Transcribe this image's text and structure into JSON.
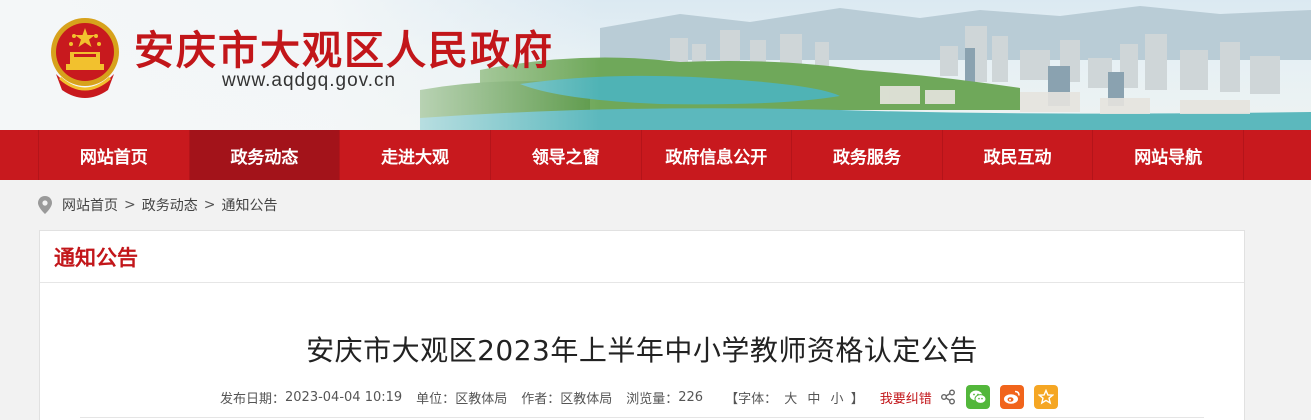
{
  "header": {
    "site_title": "安庆市大观区人民政府",
    "site_url": "www.aqdgq.gov.cn"
  },
  "nav": {
    "items": [
      {
        "label": "网站首页"
      },
      {
        "label": "政务动态"
      },
      {
        "label": "走进大观"
      },
      {
        "label": "领导之窗"
      },
      {
        "label": "政府信息公开"
      },
      {
        "label": "政务服务"
      },
      {
        "label": "政民互动"
      },
      {
        "label": "网站导航"
      }
    ],
    "active_index": 1
  },
  "breadcrumb": {
    "items": [
      "网站首页",
      "政务动态",
      "通知公告"
    ],
    "separator": ">"
  },
  "panel": {
    "heading": "通知公告"
  },
  "article": {
    "title": "安庆市大观区2023年上半年中小学教师资格认定公告",
    "meta": {
      "date_label": "发布日期：",
      "date_value": "2023-04-04 10:19",
      "unit_label": "单位：",
      "unit_value": "区教体局",
      "author_label": "作者：",
      "author_value": "区教体局",
      "views_label": "浏览量：",
      "views_value": "226",
      "font_open": "【字体：",
      "font_large": "大",
      "font_medium": "中",
      "font_small": "小",
      "font_close": "】",
      "correction": "我要纠错"
    }
  },
  "colors": {
    "brand_red": "#c8191e",
    "nav_active": "#a3131a",
    "title_red": "#c2161a"
  },
  "icons": [
    "national-emblem-icon",
    "location-pin-icon",
    "share-icon",
    "wechat-icon",
    "weibo-icon",
    "favorite-star-icon"
  ]
}
